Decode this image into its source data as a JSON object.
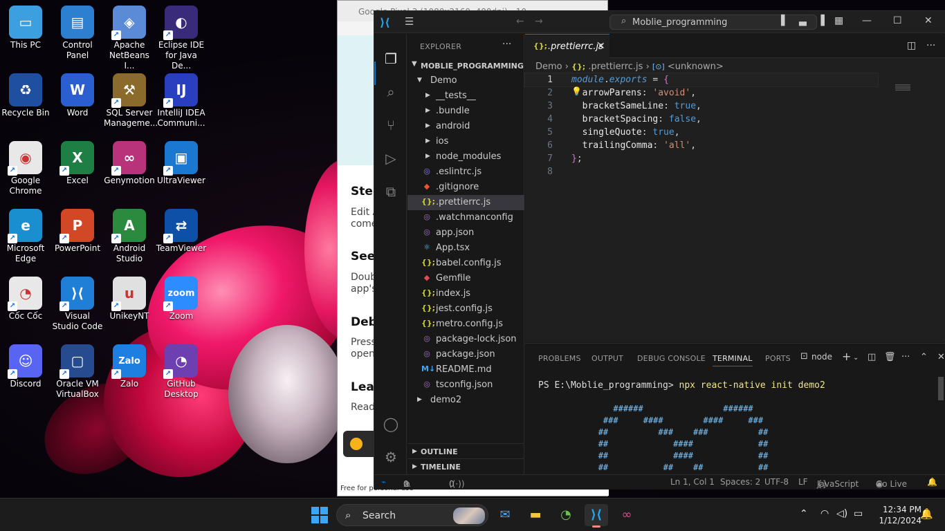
{
  "desktop": {
    "icons": [
      {
        "label": "This PC",
        "icon": "monitor-icon"
      },
      {
        "label": "Control Panel",
        "icon": "control-panel-icon"
      },
      {
        "label": "Apache NetBeans I...",
        "icon": "netbeans-icon"
      },
      {
        "label": "Eclipse IDE for Java De...",
        "icon": "eclipse-icon"
      },
      {
        "label": "Recycle Bin",
        "icon": "recycle-bin-icon"
      },
      {
        "label": "Word",
        "icon": "word-icon"
      },
      {
        "label": "SQL Server Manageme...",
        "icon": "sql-server-icon"
      },
      {
        "label": "IntelliJ IDEA Communi...",
        "icon": "intellij-icon"
      },
      {
        "label": "Google Chrome",
        "icon": "chrome-icon"
      },
      {
        "label": "Excel",
        "icon": "excel-icon"
      },
      {
        "label": "Genymotion",
        "icon": "genymotion-icon"
      },
      {
        "label": "UltraViewer",
        "icon": "ultraviewer-icon"
      },
      {
        "label": "Microsoft Edge",
        "icon": "edge-icon"
      },
      {
        "label": "PowerPoint",
        "icon": "powerpoint-icon"
      },
      {
        "label": "Android Studio",
        "icon": "android-studio-icon"
      },
      {
        "label": "TeamViewer",
        "icon": "teamviewer-icon"
      },
      {
        "label": "Cốc Cốc",
        "icon": "coccoc-icon"
      },
      {
        "label": "Visual Studio Code",
        "icon": "vscode-icon"
      },
      {
        "label": "UnikeyNT",
        "icon": "unikey-icon"
      },
      {
        "label": "Zoom",
        "icon": "zoom-icon"
      },
      {
        "label": "Discord",
        "icon": "discord-icon"
      },
      {
        "label": "Oracle VM VirtualBox",
        "icon": "virtualbox-icon"
      },
      {
        "label": "Zalo",
        "icon": "zalo-icon"
      },
      {
        "label": "GitHub Desktop",
        "icon": "github-desktop-icon"
      }
    ]
  },
  "phone_window": {
    "title": "Google Pixel 3 (1080x2160, 480dpi) - 10...",
    "headings": [
      "Step",
      "See",
      "Debu",
      "Lear"
    ],
    "subtexts": [
      "Edit A",
      "come",
      "Doub",
      "app's",
      "Press",
      "open",
      "Read"
    ],
    "footer": "Free for personal use"
  },
  "vscode": {
    "search_label": "Moblie_programming",
    "explorer": {
      "header": "EXPLORER",
      "project": "MOBLIE_PROGRAMMING",
      "rows": [
        {
          "name": "Demo",
          "kind": "folder-open",
          "indent": 1
        },
        {
          "name": "__tests__",
          "kind": "folder",
          "indent": 2
        },
        {
          "name": ".bundle",
          "kind": "folder",
          "indent": 2
        },
        {
          "name": "android",
          "kind": "folder",
          "indent": 2
        },
        {
          "name": "ios",
          "kind": "folder",
          "indent": 2
        },
        {
          "name": "node_modules",
          "kind": "folder",
          "indent": 2
        },
        {
          "name": ".eslintrc.js",
          "kind": "eslint",
          "indent": 2
        },
        {
          "name": ".gitignore",
          "kind": "git",
          "indent": 2
        },
        {
          "name": ".prettierrc.js",
          "kind": "js",
          "indent": 2,
          "selected": true
        },
        {
          "name": ".watchmanconfig",
          "kind": "config",
          "indent": 2
        },
        {
          "name": "app.json",
          "kind": "config",
          "indent": 2
        },
        {
          "name": "App.tsx",
          "kind": "react",
          "indent": 2
        },
        {
          "name": "babel.config.js",
          "kind": "js",
          "indent": 2
        },
        {
          "name": "Gemfile",
          "kind": "ruby",
          "indent": 2
        },
        {
          "name": "index.js",
          "kind": "js",
          "indent": 2
        },
        {
          "name": "jest.config.js",
          "kind": "js",
          "indent": 2
        },
        {
          "name": "metro.config.js",
          "kind": "js",
          "indent": 2
        },
        {
          "name": "package-lock.json",
          "kind": "config",
          "indent": 2
        },
        {
          "name": "package.json",
          "kind": "config",
          "indent": 2
        },
        {
          "name": "README.md",
          "kind": "md",
          "indent": 2
        },
        {
          "name": "tsconfig.json",
          "kind": "config",
          "indent": 2
        },
        {
          "name": "demo2",
          "kind": "folder",
          "indent": 1
        }
      ],
      "outline": "OUTLINE",
      "timeline": "TIMELINE"
    },
    "tab": {
      "label": ".prettierrc.js",
      "icon": "{};"
    },
    "breadcrumb": {
      "root": "Demo",
      "file": ".prettierrc.js",
      "symbol": "<unknown>"
    },
    "code_lines": [
      {
        "n": "1",
        "parts": [
          [
            "module",
            "kw"
          ],
          [
            ".",
            "op"
          ],
          [
            "exports",
            "kw"
          ],
          [
            " = ",
            "op"
          ],
          [
            "{",
            "brace"
          ]
        ]
      },
      {
        "n": "2",
        "parts": [
          [
            "  arrowParens",
            "pn"
          ],
          [
            ": ",
            "op"
          ],
          [
            "'avoid'",
            "str"
          ],
          [
            ",",
            "op"
          ]
        ]
      },
      {
        "n": "3",
        "parts": [
          [
            "  bracketSameLine",
            "pn"
          ],
          [
            ": ",
            "op"
          ],
          [
            "true",
            "bool"
          ],
          [
            ",",
            "op"
          ]
        ]
      },
      {
        "n": "4",
        "parts": [
          [
            "  bracketSpacing",
            "pn"
          ],
          [
            ": ",
            "op"
          ],
          [
            "false",
            "bool"
          ],
          [
            ",",
            "op"
          ]
        ]
      },
      {
        "n": "5",
        "parts": [
          [
            "  singleQuote",
            "pn"
          ],
          [
            ": ",
            "op"
          ],
          [
            "true",
            "bool"
          ],
          [
            ",",
            "op"
          ]
        ]
      },
      {
        "n": "6",
        "parts": [
          [
            "  trailingComma",
            "pn"
          ],
          [
            ": ",
            "op"
          ],
          [
            "'all'",
            "str"
          ],
          [
            ",",
            "op"
          ]
        ]
      },
      {
        "n": "7",
        "parts": [
          [
            "}",
            "brace"
          ],
          [
            ";",
            "op"
          ]
        ]
      },
      {
        "n": "8",
        "parts": []
      }
    ],
    "panel": {
      "tabs": [
        "PROBLEMS",
        "OUTPUT",
        "DEBUG CONSOLE",
        "TERMINAL",
        "PORTS"
      ],
      "active_tab": "TERMINAL",
      "terminal_name": "node",
      "prompt": "PS E:\\Moblie_programming>",
      "command": "npx react-native init demo2",
      "ascii_art": "               ######                ######\n             ###     ####        ####     ###\n            ##          ###    ###          ##\n            ##             ####             ##\n            ##             ####             ##\n            ##           ##    ##           ##"
    },
    "status": {
      "errors": "0",
      "warnings": "0",
      "ports": "0",
      "position": "Ln 1, Col 1",
      "spaces": "Spaces: 2",
      "encoding": "UTF-8",
      "eol": "LF",
      "language": "JavaScript",
      "golive": "Go Live"
    }
  },
  "taskbar": {
    "search_label": "Search",
    "apps": [
      "mail-icon",
      "file-explorer-icon",
      "coccoc-icon",
      "vscode-icon",
      "genymotion-icon"
    ],
    "time": "12:34 PM",
    "date": "1/12/2024"
  }
}
